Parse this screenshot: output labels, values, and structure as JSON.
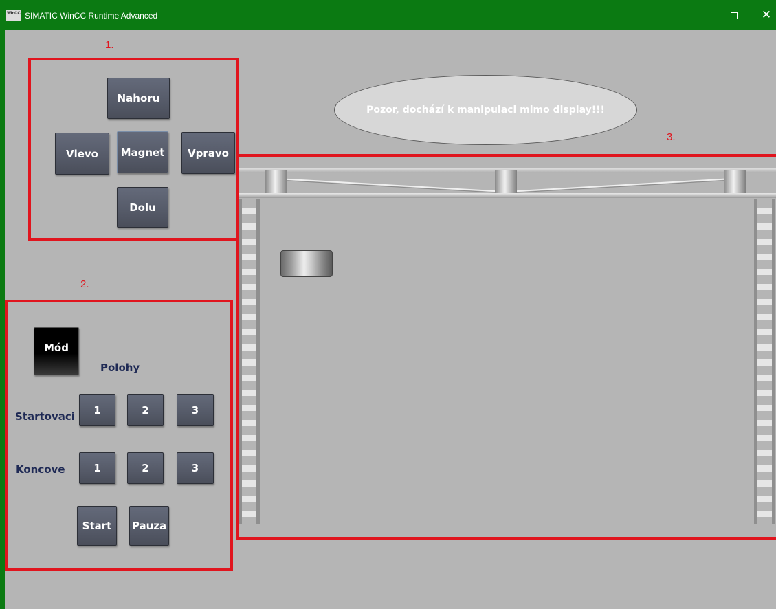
{
  "window": {
    "icon_text": "WinCC",
    "title": "SIMATIC WinCC Runtime Advanced",
    "minimize": "–",
    "close": "✕"
  },
  "annotations": [
    "1.",
    "2.",
    "3."
  ],
  "manual_control": {
    "up": "Nahoru",
    "left": "Vlevo",
    "magnet": "Magnet",
    "right": "Vpravo",
    "down": "Dolu"
  },
  "auto_control": {
    "mode": "Mód",
    "positions_label": "Polohy",
    "start_label": "Startovaci",
    "end_label": "Koncove",
    "start_positions": [
      "1",
      "2",
      "3"
    ],
    "end_positions": [
      "1",
      "2",
      "3"
    ],
    "start_button": "Start",
    "pause_button": "Pauza"
  },
  "warning": "Pozor, dochází k manipulaci mimo display!!!",
  "colors": {
    "titlebar": "#0b7a12",
    "background": "#b5b5b5",
    "annotation": "#e0151e",
    "button": "#555a68",
    "label": "#1f2a55"
  }
}
